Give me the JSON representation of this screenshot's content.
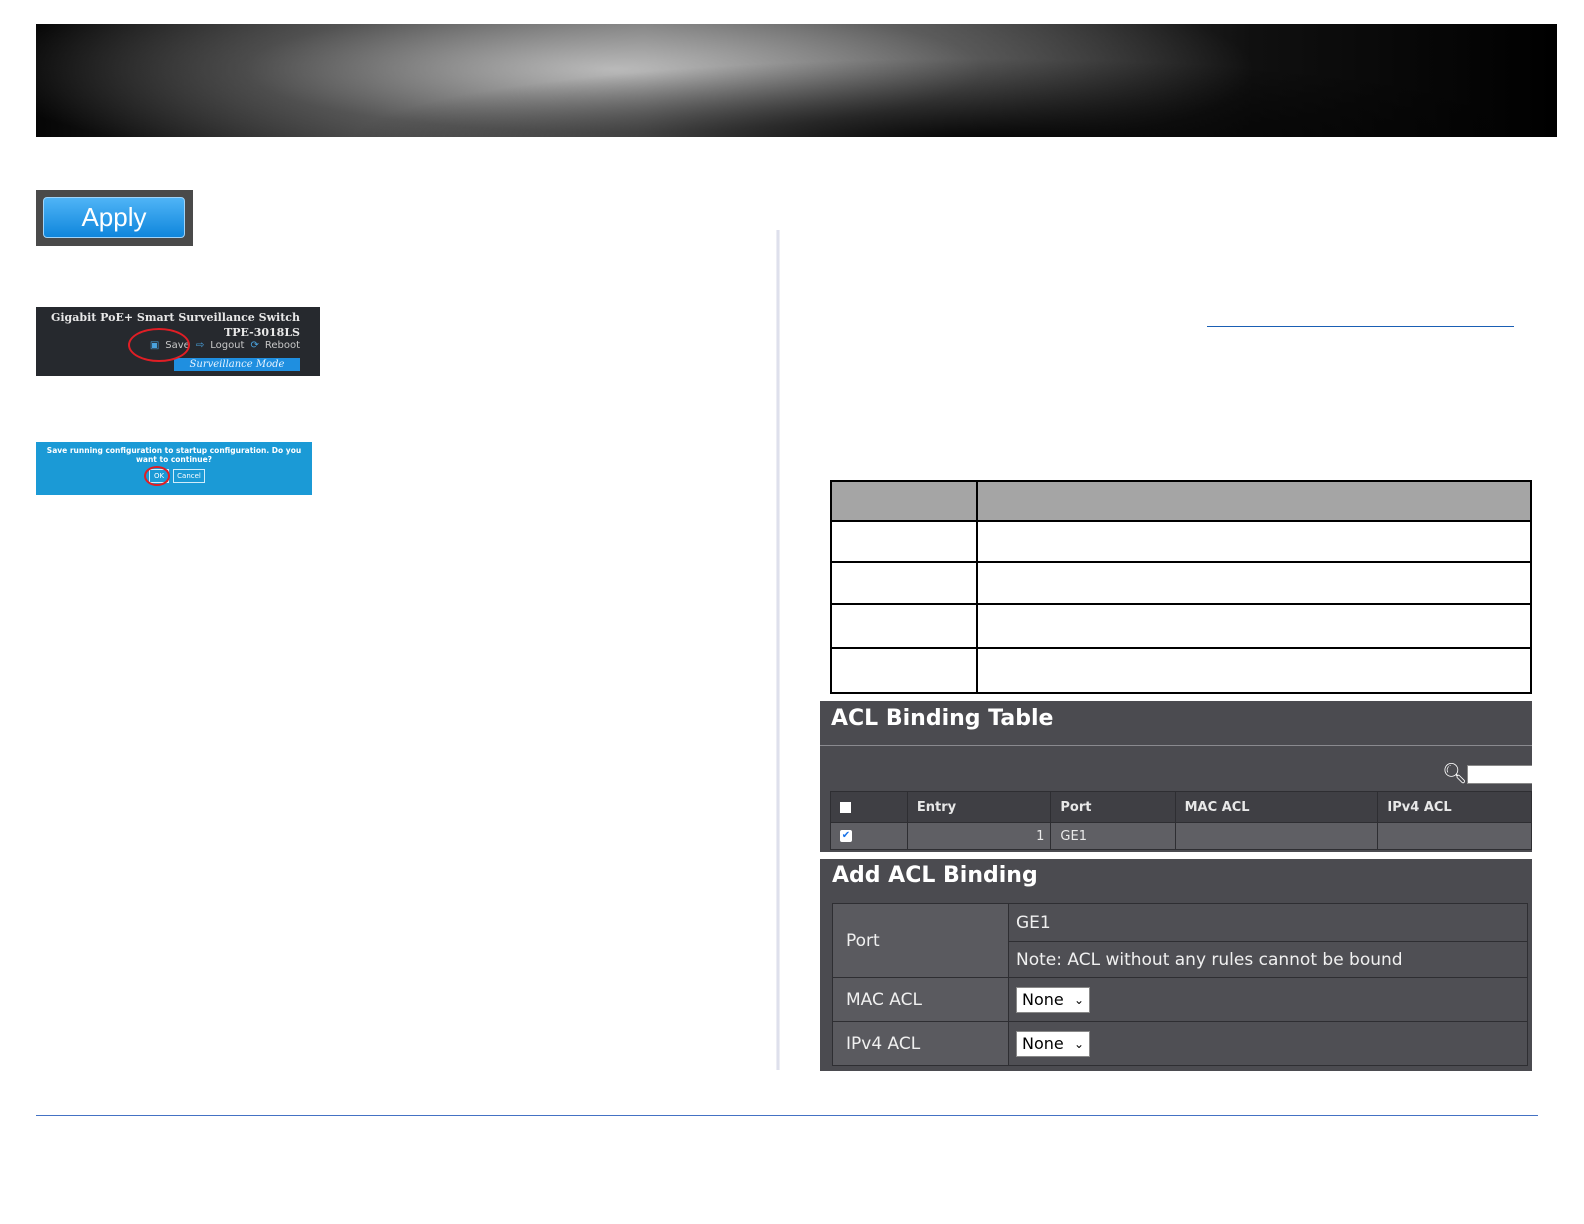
{
  "apply_button": {
    "label": "Apply"
  },
  "save_screenshot": {
    "title": "Gigabit PoE+ Smart Surveillance Switch",
    "model": "TPE-3018LS",
    "save_label": "Save",
    "logout_label": "Logout",
    "reboot_label": "Reboot",
    "mode_label": "Surveillance Mode"
  },
  "confirm_dialog": {
    "message": "Save running configuration to startup configuration. Do you want to continue?",
    "ok_label": "OK",
    "cancel_label": "Cancel"
  },
  "acl_binding_table": {
    "title": "ACL Binding Table",
    "columns": [
      "Entry",
      "Port",
      "MAC ACL",
      "IPv4 ACL"
    ],
    "rows": [
      {
        "entry": "1",
        "port": "GE1",
        "mac_acl": "",
        "ipv4_acl": ""
      }
    ]
  },
  "add_acl_binding": {
    "title": "Add ACL Binding",
    "port_label": "Port",
    "port_value": "GE1",
    "note": "Note: ACL without any rules cannot be bound",
    "mac_acl_label": "MAC ACL",
    "mac_acl_value": "None",
    "ipv4_acl_label": "IPv4 ACL",
    "ipv4_acl_value": "None"
  },
  "colors": {
    "accent_blue": "#1b9ad6",
    "panel_gray": "#4b4b50",
    "highlight_red": "#e01e25",
    "rule_blue": "#4472c4"
  }
}
